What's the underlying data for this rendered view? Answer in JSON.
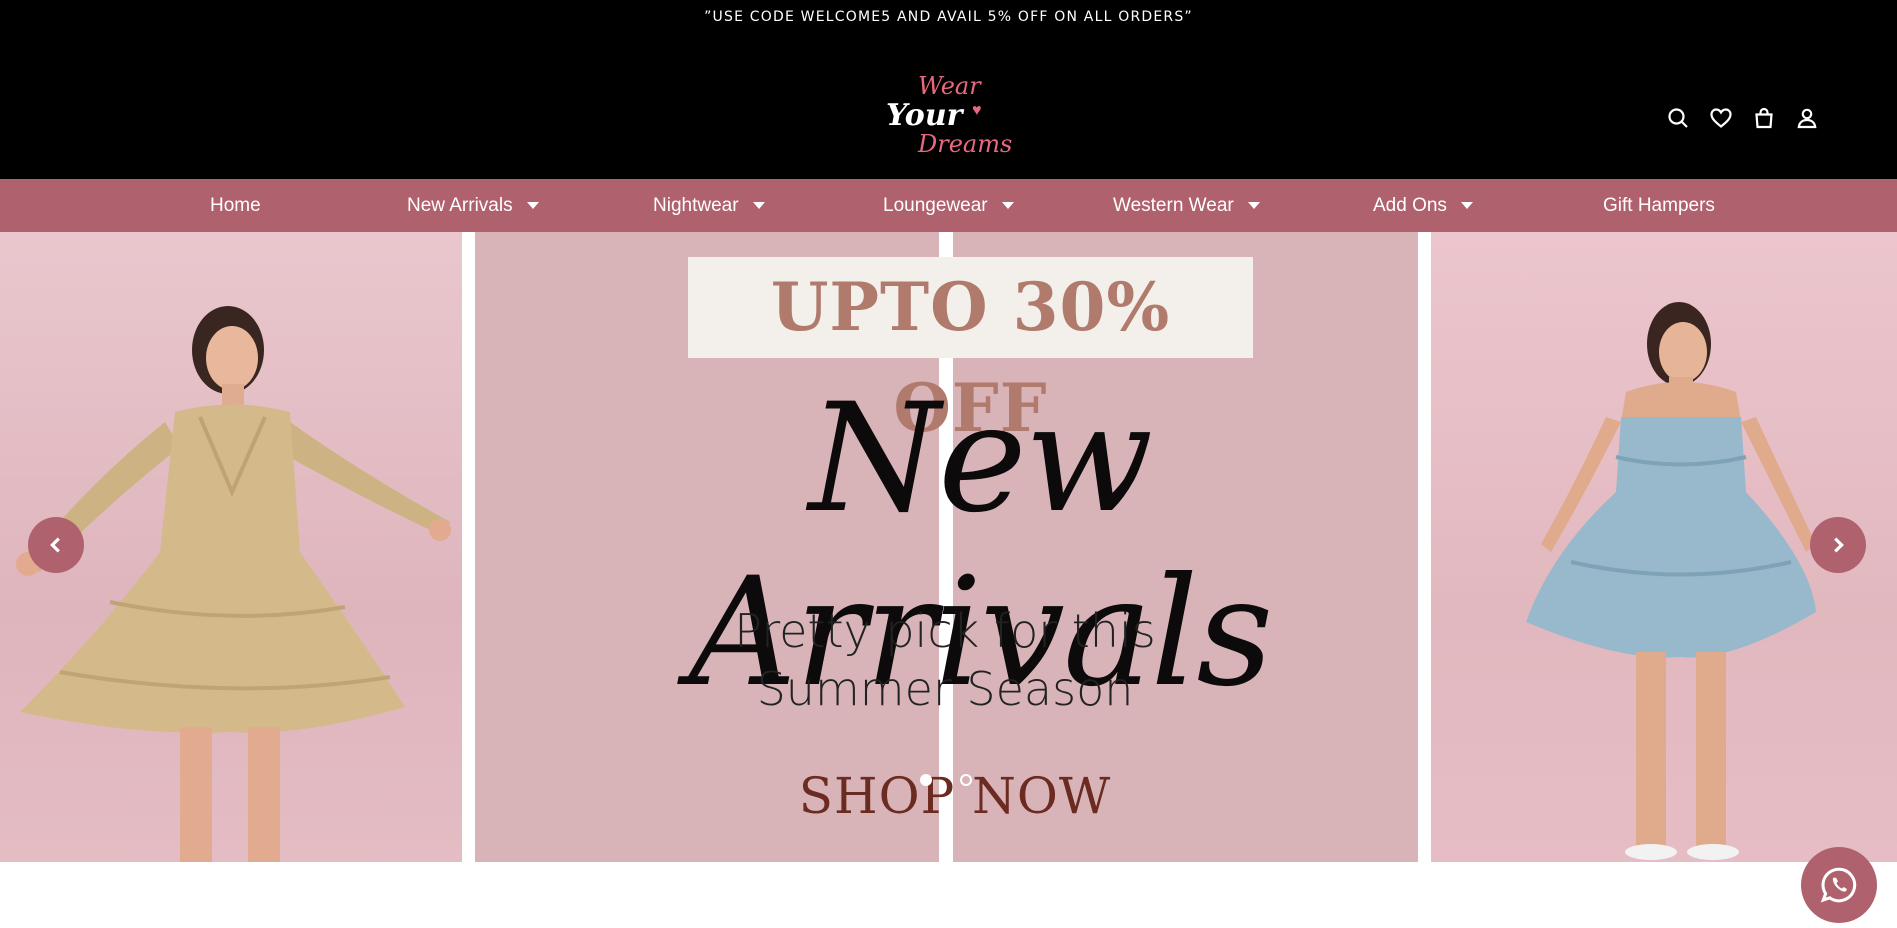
{
  "announcement": "”USE CODE WELCOME5 AND AVAIL 5% OFF ON ALL ORDERS”",
  "logo": {
    "line1": "Wear",
    "line2": "Your",
    "line3": "Dreams"
  },
  "header_icons": [
    "search-icon",
    "heart-icon",
    "bag-icon",
    "user-icon"
  ],
  "nav": {
    "items": [
      {
        "label": "Home",
        "dropdown": false
      },
      {
        "label": "New Arrivals",
        "dropdown": true
      },
      {
        "label": "Nightwear",
        "dropdown": true
      },
      {
        "label": "Loungewear",
        "dropdown": true
      },
      {
        "label": "Western Wear",
        "dropdown": true
      },
      {
        "label": "Add Ons",
        "dropdown": true
      },
      {
        "label": "Gift Hampers",
        "dropdown": false
      }
    ]
  },
  "hero": {
    "promo": "UPTO 30% OFF",
    "headline": "New Arrivals",
    "sub_line1": "Pretty pick for this",
    "sub_line2": "Summer Season",
    "cta": "SHOP NOW",
    "active_slide": 1,
    "slide_count": 2
  },
  "colors": {
    "accent": "#b0616e",
    "promo_text": "#b07a6c",
    "cta": "#6b2b20",
    "logo_pink": "#e8697f"
  }
}
